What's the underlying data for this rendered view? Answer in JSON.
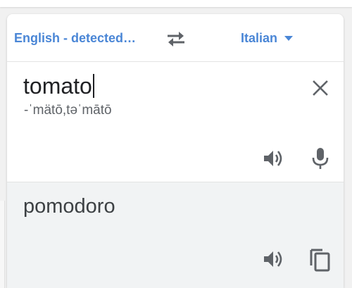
{
  "language_bar": {
    "source_language": "English - detected…",
    "target_language": "Italian",
    "swap_icon": "swap-horizontal-icon",
    "dropdown_icon": "caret-down-icon"
  },
  "input": {
    "text": "tomato",
    "phonetic": "-ˈmätō,təˈmātō",
    "clear_icon": "close-icon",
    "speak_icon": "speaker-icon",
    "mic_icon": "microphone-icon"
  },
  "output": {
    "text": "pomodoro",
    "speak_icon": "speaker-icon",
    "copy_icon": "copy-icon"
  },
  "colors": {
    "accent": "#4a86d6",
    "icon": "#5f6368",
    "result_bg": "#f1f3f4"
  }
}
